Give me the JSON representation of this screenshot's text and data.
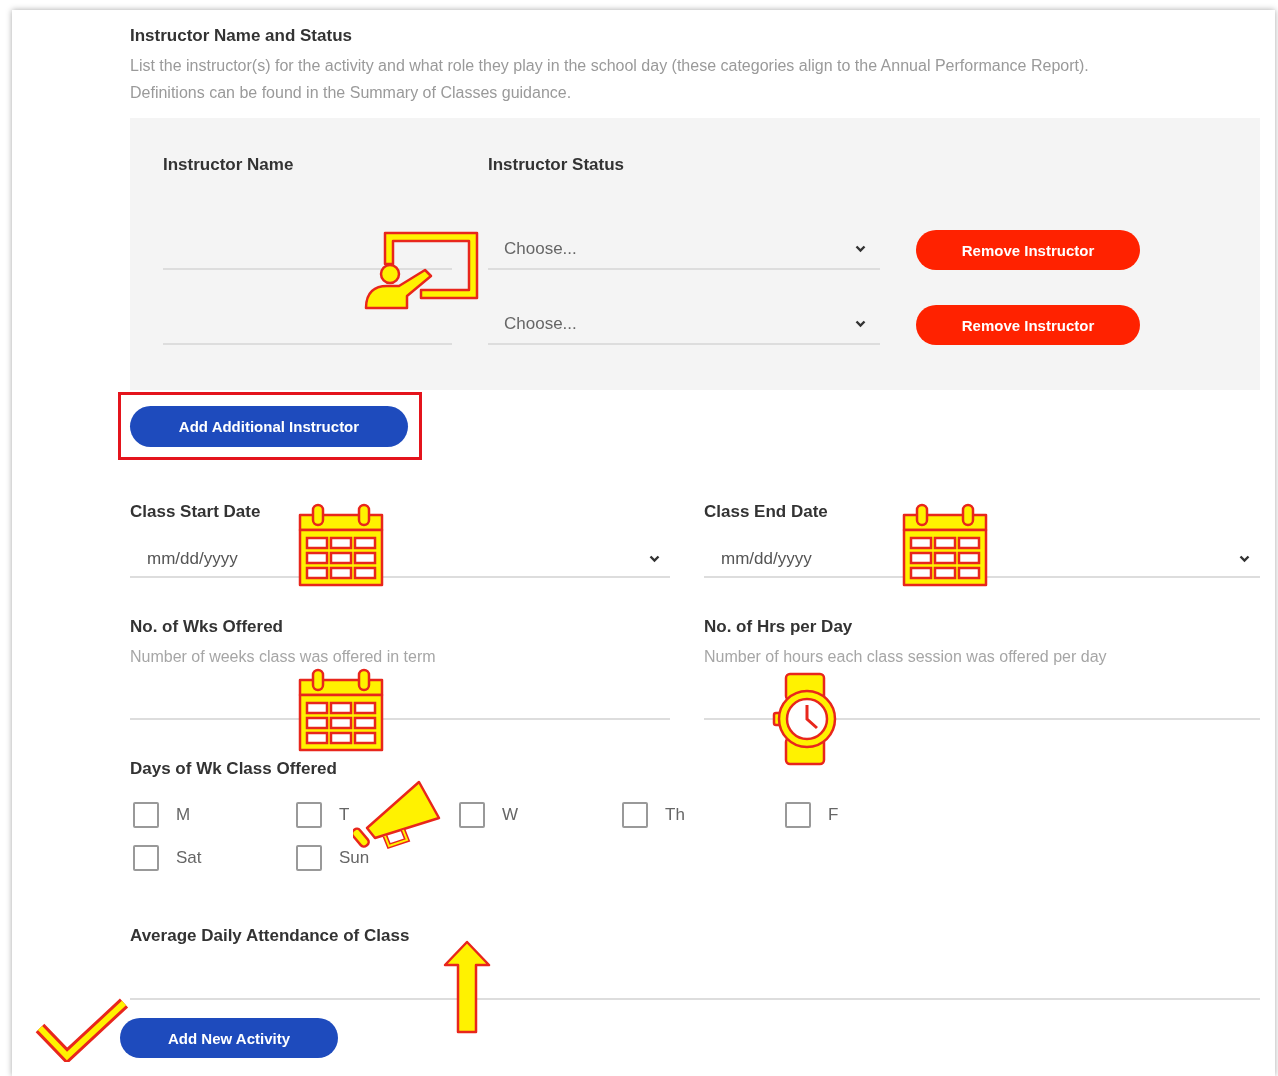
{
  "section": {
    "title": "Instructor Name and Status",
    "description": "List the instructor(s) for the activity and what role they play in the school day (these categories align to the Annual Performance Report). Definitions can be found in the Summary of Classes guidance."
  },
  "instructor_table": {
    "columns": [
      "Instructor Name",
      "Instructor Status"
    ],
    "rows": [
      {
        "status_placeholder": "Choose...",
        "remove_button": "Remove Instructor"
      },
      {
        "status_placeholder": "Choose...",
        "remove_button": "Remove Instructor"
      }
    ]
  },
  "add_instructor_button": {
    "label": "Add Additional Instructor",
    "highlighted": true
  },
  "dates": [
    {
      "label": "Class Start Date",
      "placeholder": "mm/dd/yyyy"
    },
    {
      "label": "Class End Date",
      "placeholder": "mm/dd/yyyy"
    }
  ],
  "numbers": [
    {
      "label": "No. of Wks Offered",
      "help": "Number of weeks class was offered in term"
    },
    {
      "label": "No. of Hrs per Day",
      "help": "Number of hours each class session was offered per day"
    }
  ],
  "days": {
    "label": "Days of Wk Class Offered",
    "options": [
      {
        "label": "M",
        "checked": false
      },
      {
        "label": "T",
        "checked": false
      },
      {
        "label": "W",
        "checked": false
      },
      {
        "label": "Th",
        "checked": false
      },
      {
        "label": "F",
        "checked": false
      },
      {
        "label": "Sat",
        "checked": false
      },
      {
        "label": "Sun",
        "checked": false
      }
    ]
  },
  "attendance": {
    "label": "Average Daily Attendance of Class"
  },
  "add_activity_button": "Add New Activity"
}
